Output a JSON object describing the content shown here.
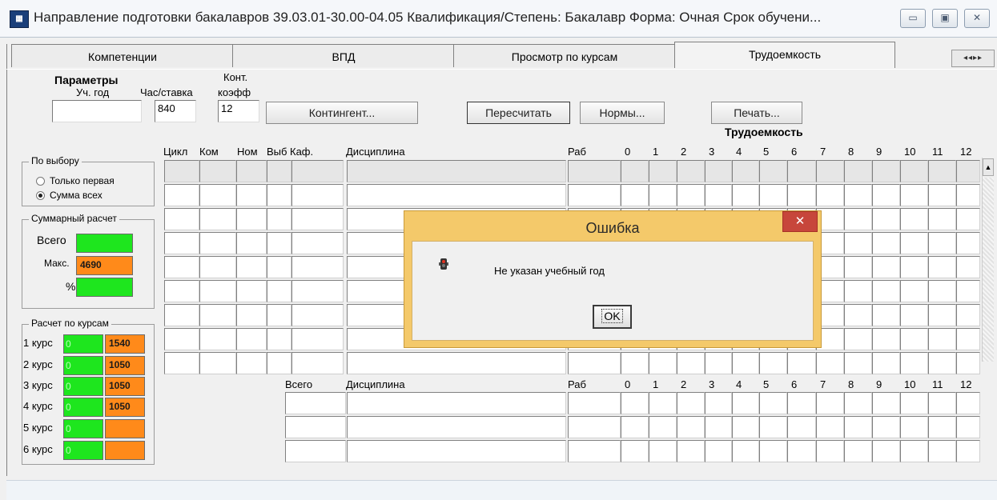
{
  "window": {
    "title": "Направление подготовки бакалавров 39.03.01-30.00-04.05 Квалификация/Степень: Бакалавр  Форма: Очная Срок обучени...",
    "app_icon": "app-grid-icon",
    "buttons": {
      "minimize": "▭",
      "restore": "▣",
      "close": "✕"
    }
  },
  "tabs": [
    {
      "label": "Компетенции",
      "active": false
    },
    {
      "label": "ВПД",
      "active": false
    },
    {
      "label": "Просмотр по курсам",
      "active": false
    },
    {
      "label": "Трудоемкость",
      "active": true
    }
  ],
  "tab_nav": "◂◂▸▸",
  "params": {
    "title": "Параметры",
    "year_label": "Уч. год",
    "year_value": "",
    "rate_label": "Час/ставка",
    "rate_value": "840",
    "coef_label_top": "Конт.",
    "coef_label_bottom": "коэфф",
    "coef_value": "12"
  },
  "toolbar": {
    "contingent": "Контингент...",
    "recalc": "Пересчитать",
    "norms": "Нормы...",
    "print": "Печать..."
  },
  "section_title": "Трудоемкость",
  "choice": {
    "title": "По выбору",
    "opt1": "Только первая",
    "opt2": "Сумма всех",
    "selected": "Сумма всех"
  },
  "summary": {
    "title": "Суммарный расчет",
    "total_label": "Всего",
    "total_value": "",
    "max_label": "Макс.",
    "max_value": "4690",
    "pct_label": "%",
    "pct_value": ""
  },
  "by_course": {
    "title": "Расчет по курсам",
    "rows": [
      {
        "label": "1 курс",
        "value": "0",
        "max": "1540"
      },
      {
        "label": "2 курс",
        "value": "0",
        "max": "1050"
      },
      {
        "label": "3 курс",
        "value": "0",
        "max": "1050"
      },
      {
        "label": "4 курс",
        "value": "0",
        "max": "1050"
      },
      {
        "label": "5 курс",
        "value": "0",
        "max": ""
      },
      {
        "label": "6 курс",
        "value": "0",
        "max": ""
      }
    ]
  },
  "grid1": {
    "col_cycle": "Цикл",
    "col_kom": "Ком",
    "col_nom": "Ном",
    "col_vyb": "Выб",
    "col_kaf": "Каф.",
    "col_disc": "Дисциплина",
    "col_rab": "Раб",
    "nums": [
      "0",
      "1",
      "2",
      "3",
      "4",
      "5",
      "6",
      "7",
      "8",
      "9",
      "10",
      "11",
      "12"
    ]
  },
  "grid2": {
    "col_total": "Всего",
    "col_disc": "Дисциплина",
    "col_rab": "Раб",
    "nums": [
      "0",
      "1",
      "2",
      "3",
      "4",
      "5",
      "6",
      "7",
      "8",
      "9",
      "10",
      "11",
      "12"
    ]
  },
  "dialog": {
    "title": "Ошибка",
    "close": "✕",
    "icon": "error-stop-icon",
    "message": "Не указан учебный год",
    "ok": "OK"
  },
  "colors": {
    "green": "#1ee61e",
    "orange": "#ff8a1a",
    "dialog_frame": "#f4c96a",
    "close_red": "#c7463b"
  }
}
